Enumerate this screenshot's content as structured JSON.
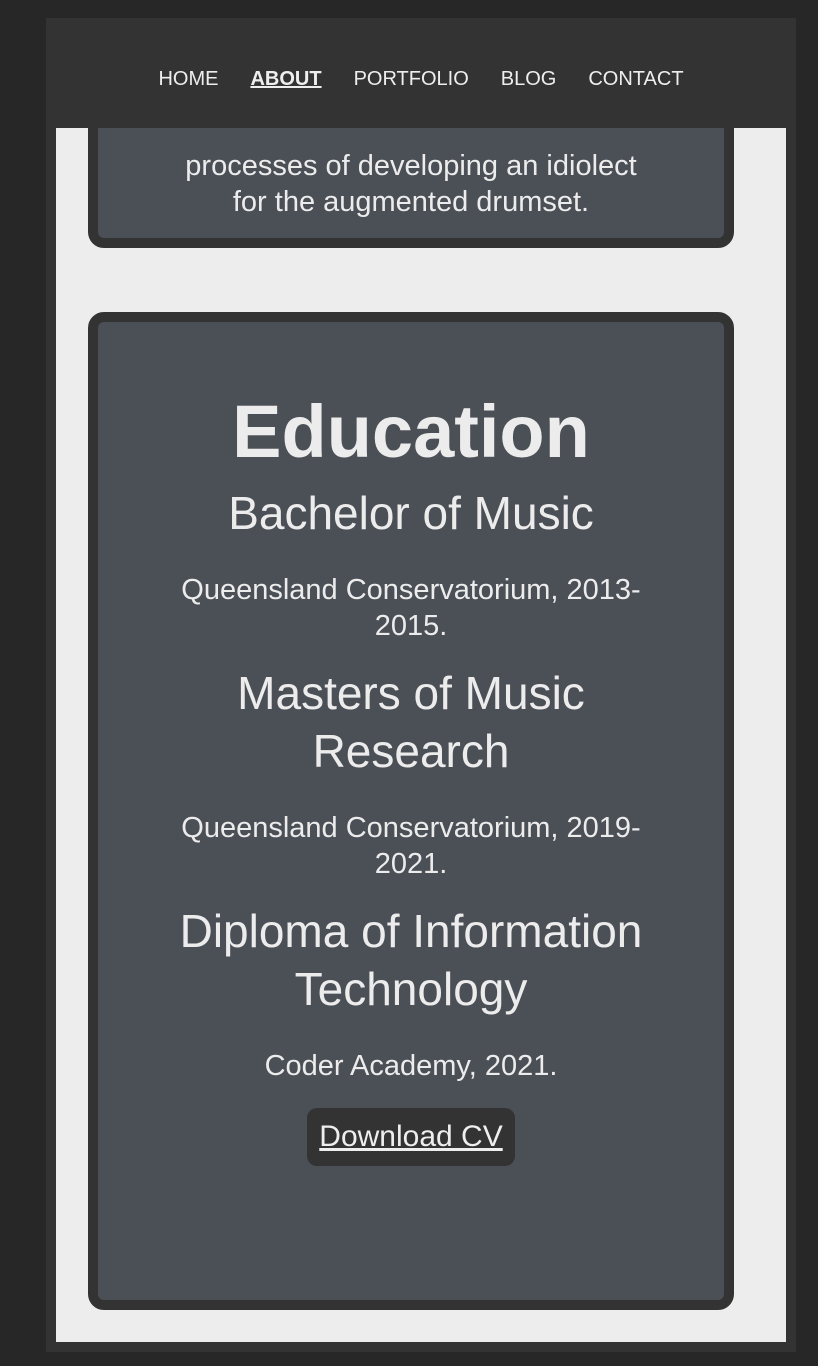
{
  "nav": {
    "items": [
      "HOME",
      "ABOUT",
      "PORTFOLIO",
      "BLOG",
      "CONTACT"
    ],
    "active": "ABOUT"
  },
  "intro_card": {
    "lines": [
      "processes of developing an idiolect",
      "for the augmented drumset."
    ]
  },
  "education": {
    "title": "Education",
    "entries": [
      {
        "degree": "Bachelor of Music",
        "details": "Queensland Conservatorium, 2013-2015."
      },
      {
        "degree": "Masters of Music Research",
        "details": "Queensland Conservatorium, 2019-2021."
      },
      {
        "degree": "Diploma of Information Technology",
        "details": "Coder Academy, 2021."
      }
    ],
    "download_label": "Download CV"
  },
  "colors": {
    "background": "#272727",
    "nav": "#333333",
    "page": "#ededed",
    "card": "#4b4f56",
    "text": "#ececec"
  }
}
